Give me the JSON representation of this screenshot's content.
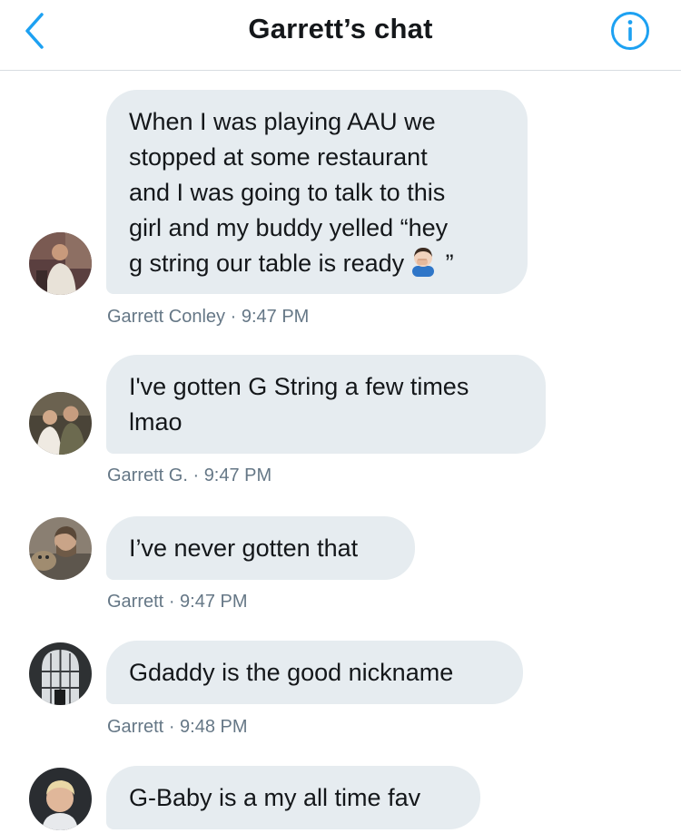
{
  "header": {
    "title": "Garrett’s chat",
    "back_icon": "chevron-left-icon",
    "info_icon": "info-icon"
  },
  "colors": {
    "accent": "#1da1f2",
    "bubble": "#e6ecf0",
    "text": "#14171a",
    "meta": "#657786"
  },
  "messages": [
    {
      "lines": [
        "When I was playing AAU we",
        "stopped at some restaurant",
        "and I was going to talk to this",
        "girl and my buddy yelled “hey",
        "g string our table is ready"
      ],
      "emoji": "face-palm-emoji",
      "trailing": " ”",
      "sender": "Garrett Conley",
      "time": "9:47 PM"
    },
    {
      "lines": [
        "I've gotten G String a few times",
        "lmao"
      ],
      "sender": "Garrett G.",
      "time": "9:47 PM"
    },
    {
      "lines": [
        "I’ve never gotten that"
      ],
      "sender": "Garrett",
      "time": "9:47 PM"
    },
    {
      "lines": [
        "Gdaddy is the good nickname"
      ],
      "sender": "Garrett",
      "time": "9:48 PM"
    },
    {
      "lines": [
        "G-Baby is a my all time fav"
      ]
    }
  ]
}
